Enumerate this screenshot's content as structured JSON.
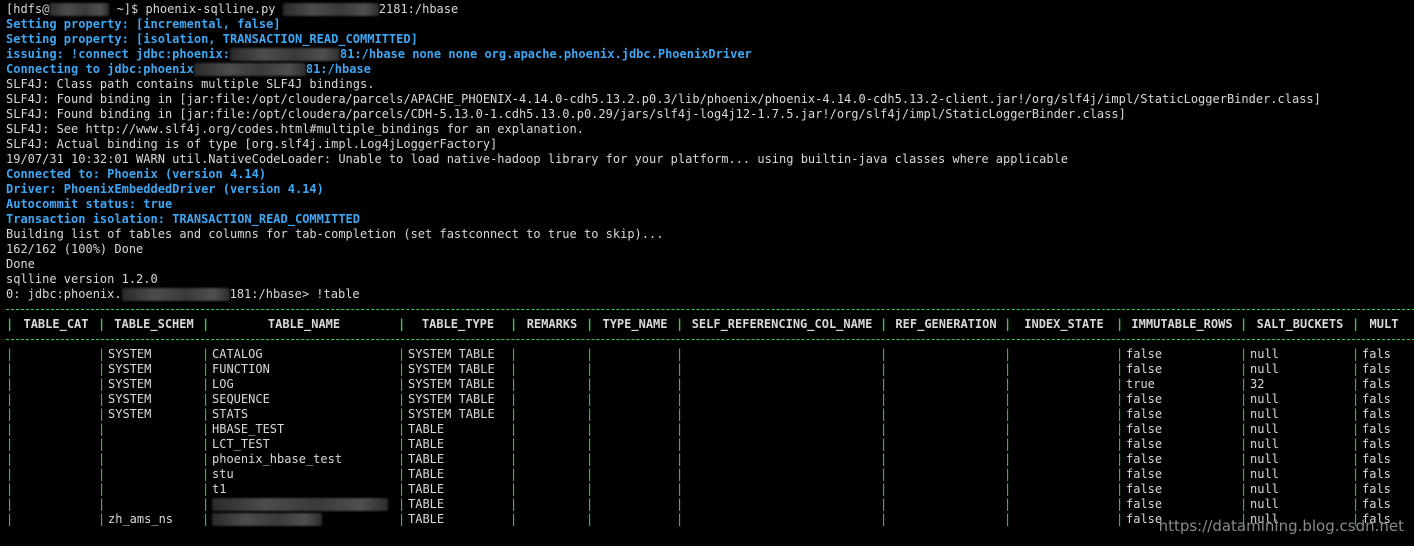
{
  "terminal": {
    "prompt_prefix": "[hdfs@",
    "prompt_suffix": " ~]$ phoenix-sqlline.py ",
    "prompt_host_tail": "2181:/hbase",
    "lines_blue_1": [
      "Setting property: [incremental, false]",
      "Setting property: [isolation, TRANSACTION_READ_COMMITTED]"
    ],
    "issuing_prefix": "issuing: !connect jdbc:phoenix:",
    "issuing_suffix": "81:/hbase none none org.apache.phoenix.jdbc.PhoenixDriver",
    "connecting_prefix": "Connecting to jdbc:phoenix",
    "connecting_suffix": "81:/hbase",
    "slf4j_lines": [
      "SLF4J: Class path contains multiple SLF4J bindings.",
      "SLF4J: Found binding in [jar:file:/opt/cloudera/parcels/APACHE_PHOENIX-4.14.0-cdh5.13.2.p0.3/lib/phoenix/phoenix-4.14.0-cdh5.13.2-client.jar!/org/slf4j/impl/StaticLoggerBinder.class]",
      "SLF4J: Found binding in [jar:file:/opt/cloudera/parcels/CDH-5.13.0-1.cdh5.13.0.p0.29/jars/slf4j-log4j12-1.7.5.jar!/org/slf4j/impl/StaticLoggerBinder.class]",
      "SLF4J: See http://www.slf4j.org/codes.html#multiple_bindings for an explanation.",
      "SLF4J: Actual binding is of type [org.slf4j.impl.Log4jLoggerFactory]",
      "19/07/31 10:32:01 WARN util.NativeCodeLoader: Unable to load native-hadoop library for your platform... using builtin-java classes where applicable"
    ],
    "lines_blue_2": [
      "Connected to: Phoenix (version 4.14)",
      "Driver: PhoenixEmbeddedDriver (version 4.14)",
      "Autocommit status: true",
      "Transaction isolation: TRANSACTION_READ_COMMITTED"
    ],
    "build_lines": [
      "Building list of tables and columns for tab-completion (set fastconnect to true to skip)...",
      "162/162 (100%) Done",
      "Done",
      "sqlline version 1.2.0"
    ],
    "sql_prompt_prefix": "0: jdbc:phoenix.",
    "sql_prompt_suffix": "181:/hbase> !table",
    "watermark": "https://datamining.blog.csdn.net"
  },
  "table": {
    "headers": [
      "TABLE_CAT",
      "TABLE_SCHEM",
      "TABLE_NAME",
      "TABLE_TYPE",
      "REMARKS",
      "TYPE_NAME",
      "SELF_REFERENCING_COL_NAME",
      "REF_GENERATION",
      "INDEX_STATE",
      "IMMUTABLE_ROWS",
      "SALT_BUCKETS",
      "MULT"
    ],
    "rows": [
      [
        "",
        "SYSTEM",
        "CATALOG",
        "SYSTEM TABLE",
        "",
        "",
        "",
        "",
        "",
        "false",
        "null",
        "fals"
      ],
      [
        "",
        "SYSTEM",
        "FUNCTION",
        "SYSTEM TABLE",
        "",
        "",
        "",
        "",
        "",
        "false",
        "null",
        "fals"
      ],
      [
        "",
        "SYSTEM",
        "LOG",
        "SYSTEM TABLE",
        "",
        "",
        "",
        "",
        "",
        "true",
        "32",
        "fals"
      ],
      [
        "",
        "SYSTEM",
        "SEQUENCE",
        "SYSTEM TABLE",
        "",
        "",
        "",
        "",
        "",
        "false",
        "null",
        "fals"
      ],
      [
        "",
        "SYSTEM",
        "STATS",
        "SYSTEM TABLE",
        "",
        "",
        "",
        "",
        "",
        "false",
        "null",
        "fals"
      ],
      [
        "",
        "",
        "HBASE_TEST",
        "TABLE",
        "",
        "",
        "",
        "",
        "",
        "false",
        "null",
        "fals"
      ],
      [
        "",
        "",
        "LCT_TEST",
        "TABLE",
        "",
        "",
        "",
        "",
        "",
        "false",
        "null",
        "fals"
      ],
      [
        "",
        "",
        "phoenix_hbase_test",
        "TABLE",
        "",
        "",
        "",
        "",
        "",
        "false",
        "null",
        "fals"
      ],
      [
        "",
        "",
        "stu",
        "TABLE",
        "",
        "",
        "",
        "",
        "",
        "false",
        "null",
        "fals"
      ],
      [
        "",
        "",
        "t1",
        "TABLE",
        "",
        "",
        "",
        "",
        "",
        "false",
        "null",
        "fals"
      ],
      [
        "",
        "",
        "",
        "TABLE",
        "",
        "",
        "",
        "",
        "",
        "false",
        "null",
        "fals"
      ],
      [
        "",
        "zh_ams_ns",
        "",
        "TABLE",
        "",
        "",
        "",
        "",
        "",
        "false",
        "null",
        "fals"
      ]
    ]
  }
}
